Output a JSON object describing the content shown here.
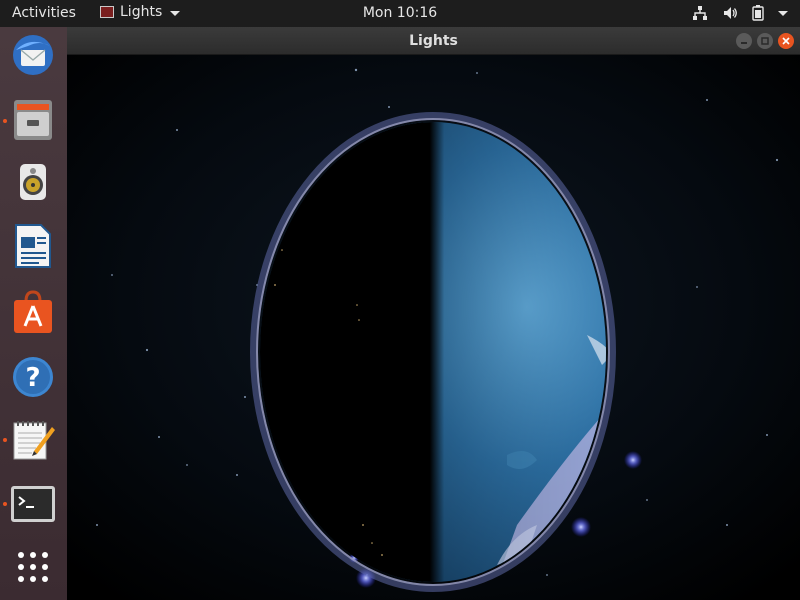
{
  "topbar": {
    "activities": "Activities",
    "app_menu_label": "Lights",
    "clock": "Mon 10:16",
    "tray_icons": [
      "network-icon",
      "volume-icon",
      "battery-icon",
      "system-menu-arrow-icon"
    ]
  },
  "dock": {
    "items": [
      {
        "name": "thunderbird-mail",
        "icon": "mail-icon",
        "running": false
      },
      {
        "name": "files",
        "icon": "file-cabinet-icon",
        "running": true
      },
      {
        "name": "rhythmbox",
        "icon": "speaker-icon",
        "running": false
      },
      {
        "name": "libreoffice-writer",
        "icon": "document-icon",
        "running": false
      },
      {
        "name": "ubuntu-software",
        "icon": "shopping-bag-icon",
        "running": false
      },
      {
        "name": "help",
        "icon": "help-icon",
        "running": false
      },
      {
        "name": "text-editor",
        "icon": "notepad-icon",
        "running": true
      },
      {
        "name": "terminal",
        "icon": "terminal-icon",
        "running": true
      },
      {
        "name": "show-applications",
        "icon": "app-grid-icon",
        "running": false
      }
    ]
  },
  "window": {
    "title": "Lights"
  },
  "colors": {
    "accent": "#e95420",
    "topbar_bg": "#1d1d1d",
    "dock_bg": "#3b2b31"
  }
}
